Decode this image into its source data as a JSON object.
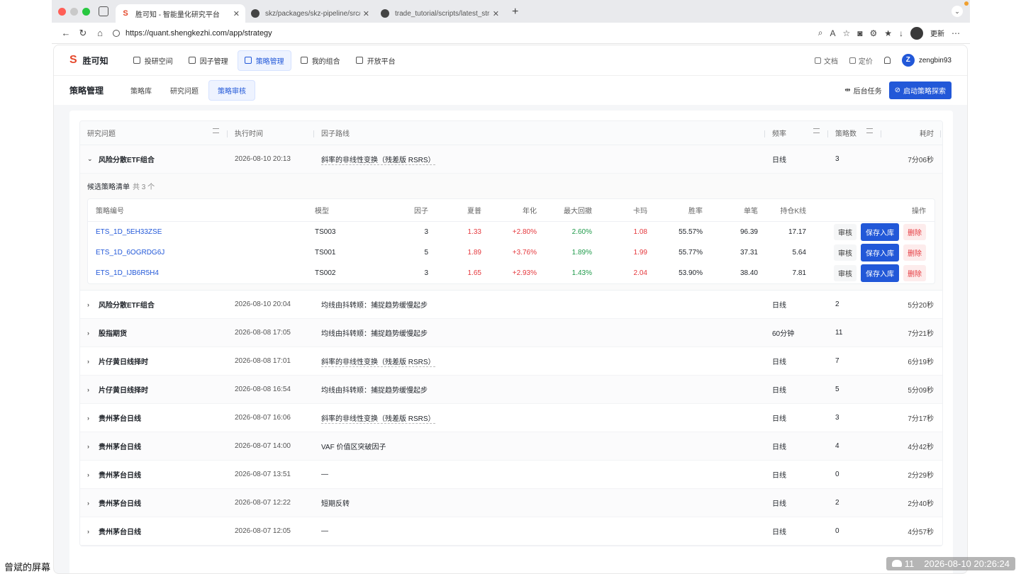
{
  "browser": {
    "tabs": [
      {
        "title": "胜可知 - 智能量化研究平台",
        "active": true
      },
      {
        "title": "skz/packages/skz-pipeline/src/s",
        "active": false
      },
      {
        "title": "trade_tutorial/scripts/latest_stra",
        "active": false
      }
    ],
    "url": "https://quant.shengkezhi.com/app/strategy",
    "update_label": "更新"
  },
  "app": {
    "logo_mark": "S",
    "name": "胜可知",
    "nav": [
      {
        "label": "投研空间",
        "icon": "chat-icon"
      },
      {
        "label": "因子管理",
        "icon": "database-icon"
      },
      {
        "label": "策略管理",
        "icon": "chart-icon",
        "active": true
      },
      {
        "label": "我的组合",
        "icon": "cube-icon"
      },
      {
        "label": "开放平台",
        "icon": "key-icon"
      }
    ],
    "docs": "文档",
    "pricing": "定价",
    "user_initial": "Z",
    "username": "zengbin93"
  },
  "subnav": {
    "title": "策略管理",
    "tabs": [
      "策略库",
      "研究问题",
      "策略审核"
    ],
    "active_tab": 2,
    "bg_tasks": "后台任务",
    "explore": "启动策略探索"
  },
  "table": {
    "headers": [
      "研究问题",
      "执行时间",
      "因子路线",
      "频率",
      "策略数",
      "耗时"
    ],
    "expanded_row": {
      "question": "风险分散ETF组合",
      "time": "2026-08-10 20:13",
      "route": "斜率的非线性变换（残差版 RSRS）",
      "freq": "日线",
      "count": "3",
      "duration": "7分06秒"
    },
    "candidates_title": "候选策略清单",
    "candidates_count": "共 3 个",
    "inner_headers": [
      "策略编号",
      "模型",
      "因子",
      "夏普",
      "年化",
      "最大回撤",
      "卡玛",
      "胜率",
      "单笔",
      "持仓K线",
      "操作"
    ],
    "candidates": [
      {
        "id": "ETS_1D_5EH33ZSE",
        "model": "TS003",
        "factors": "3",
        "sharpe": "1.33",
        "annual": "+2.80%",
        "mdd": "2.60%",
        "calmar": "1.08",
        "winrate": "55.57%",
        "per_trade": "96.39",
        "hold": "17.17"
      },
      {
        "id": "ETS_1D_6OGRDG6J",
        "model": "TS001",
        "factors": "5",
        "sharpe": "1.89",
        "annual": "+3.76%",
        "mdd": "1.89%",
        "calmar": "1.99",
        "winrate": "55.77%",
        "per_trade": "37.31",
        "hold": "5.64"
      },
      {
        "id": "ETS_1D_IJB6R5H4",
        "model": "TS002",
        "factors": "3",
        "sharpe": "1.65",
        "annual": "+2.93%",
        "mdd": "1.43%",
        "calmar": "2.04",
        "winrate": "53.90%",
        "per_trade": "38.40",
        "hold": "7.81"
      }
    ],
    "actions": {
      "review": "审核",
      "save": "保存入库",
      "delete": "删除"
    },
    "rows": [
      {
        "question": "风险分散ETF组合",
        "time": "2026-08-10 20:04",
        "route": "均线由抖转顺：捕捉趋势缓慢起步",
        "freq": "日线",
        "count": "2",
        "duration": "5分20秒"
      },
      {
        "question": "股指期货",
        "time": "2026-08-08 17:05",
        "route": "均线由抖转顺：捕捉趋势缓慢起步",
        "freq": "60分钟",
        "count": "11",
        "duration": "7分21秒"
      },
      {
        "question": "片仔黄日线择时",
        "time": "2026-08-08 17:01",
        "route": "斜率的非线性变换（残差版 RSRS）",
        "freq": "日线",
        "count": "7",
        "duration": "6分19秒"
      },
      {
        "question": "片仔黄日线择时",
        "time": "2026-08-08 16:54",
        "route": "均线由抖转顺：捕捉趋势缓慢起步",
        "freq": "日线",
        "count": "5",
        "duration": "5分09秒"
      },
      {
        "question": "贵州茅台日线",
        "time": "2026-08-07 16:06",
        "route": "斜率的非线性变换（残差版 RSRS）",
        "freq": "日线",
        "count": "3",
        "duration": "7分17秒"
      },
      {
        "question": "贵州茅台日线",
        "time": "2026-08-07 14:00",
        "route": "VAF 价值区突破因子",
        "freq": "日线",
        "count": "4",
        "duration": "4分42秒"
      },
      {
        "question": "贵州茅台日线",
        "time": "2026-08-07 13:51",
        "route": "—",
        "freq": "日线",
        "count": "0",
        "duration": "2分29秒"
      },
      {
        "question": "贵州茅台日线",
        "time": "2026-08-07 12:22",
        "route": "短期反转",
        "freq": "日线",
        "count": "2",
        "duration": "2分40秒"
      },
      {
        "question": "贵州茅台日线",
        "time": "2026-08-07 12:05",
        "route": "—",
        "freq": "日线",
        "count": "0",
        "duration": "4分57秒"
      }
    ]
  },
  "overlay": {
    "screen_label": "曾斌的屏幕",
    "participants": "11",
    "timestamp": "2026-08-10 20:26:24"
  }
}
